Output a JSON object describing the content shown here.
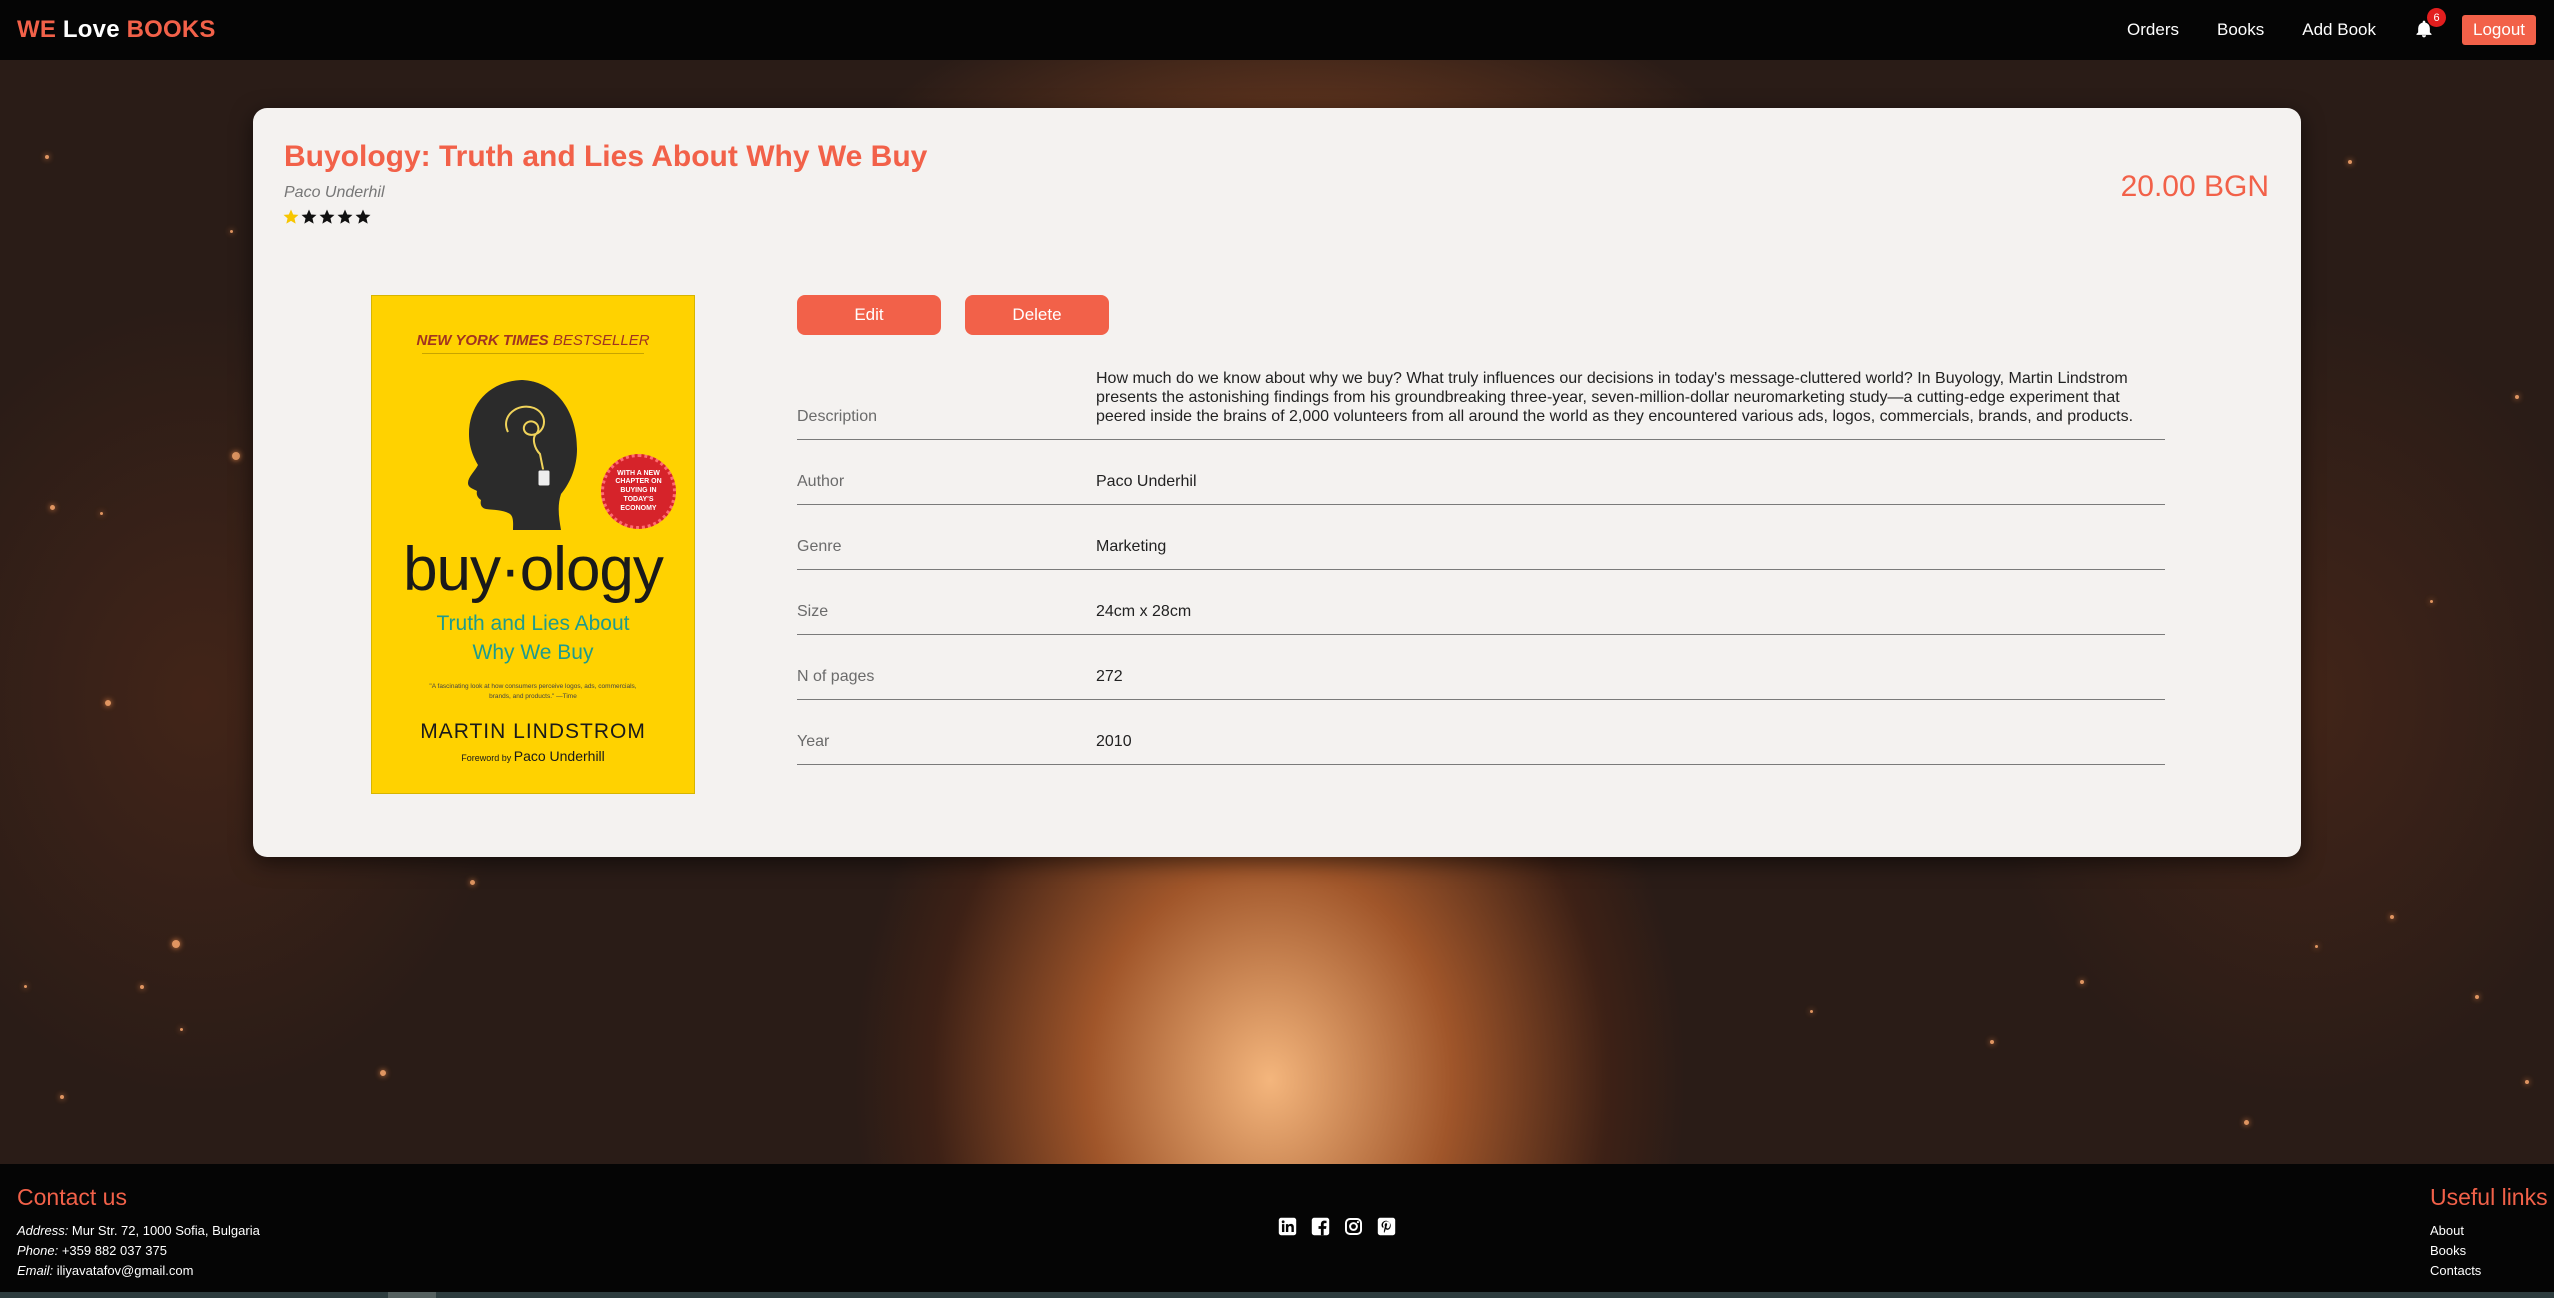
{
  "navbar": {
    "brand_we": "WE",
    "brand_love": " Love ",
    "brand_books": "BOOKS",
    "links": [
      "Orders",
      "Books",
      "Add Book"
    ],
    "notification_count": "6",
    "logout_label": "Logout"
  },
  "book": {
    "title": "Buyology: Truth and Lies About Why We Buy",
    "author": "Paco Underhil",
    "rating": 1,
    "rating_max": 5,
    "price": "20.00 BGN",
    "cover": {
      "top_line_1": "NEW YORK TIMES",
      "top_line_2": " BESTSELLER",
      "seal_text": "WITH A NEW CHAPTER ON BUYING IN TODAY'S ECONOMY",
      "word": "buy·ology",
      "subtitle_1": "Truth and Lies About",
      "subtitle_2": "Why We Buy",
      "quote": "\"A fascinating look at how consumers perceive logos, ads, commercials, brands, and products.\" —Time",
      "author": "MARTIN LINDSTROM",
      "foreword_prefix": "Foreword by ",
      "foreword_name": "Paco Underhill"
    }
  },
  "actions": {
    "edit_label": "Edit",
    "delete_label": "Delete"
  },
  "details": [
    {
      "label": "Description",
      "value": "How much do we know about why we buy? What truly influences our decisions in today's message-cluttered world? In Buyology, Martin Lindstrom presents the astonishing findings from his groundbreaking three-year, seven-million-dollar neuromarketing study—a cutting-edge experiment that peered inside the brains of 2,000 volunteers from all around the world as they encountered various ads, logos, commercials, brands, and products."
    },
    {
      "label": "Author",
      "value": "Paco Underhil"
    },
    {
      "label": "Genre",
      "value": "Marketing"
    },
    {
      "label": "Size",
      "value": "24cm x 28cm"
    },
    {
      "label": "N of pages",
      "value": "272"
    },
    {
      "label": "Year",
      "value": "2010"
    }
  ],
  "footer": {
    "contact_heading": "Contact us",
    "address_label": "Address:",
    "address": " Mur Str. 72, 1000 Sofia, Bulgaria",
    "phone_label": "Phone:",
    "phone": " +359 882 037 375",
    "email_label": "Email:",
    "email": " iliyavatafov@gmail.com",
    "socials": [
      "linkedin-icon",
      "facebook-icon",
      "instagram-icon",
      "pinterest-icon"
    ],
    "links_heading": "Useful links",
    "links": [
      "About",
      "Books",
      "Contacts"
    ]
  },
  "colors": {
    "accent": "#f26149",
    "star_filled": "#f7c600",
    "star_empty": "#111111"
  }
}
